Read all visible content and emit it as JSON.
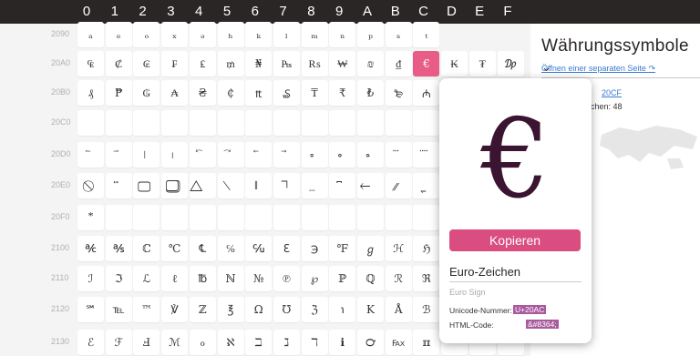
{
  "hex_columns": [
    "0",
    "1",
    "2",
    "3",
    "4",
    "5",
    "6",
    "7",
    "8",
    "9",
    "A",
    "B",
    "C",
    "D",
    "E",
    "F"
  ],
  "rows": [
    {
      "label": "2090",
      "cells": [
        "ₐ",
        "ₑ",
        "ₒ",
        "ₓ",
        "ₔ",
        "ₕ",
        "ₖ",
        "ₗ",
        "ₘ",
        "ₙ",
        "ₚ",
        "ₛ",
        "ₜ",
        "",
        "",
        ""
      ]
    },
    {
      "label": "20A0",
      "cells": [
        "₠",
        "₡",
        "₢",
        "₣",
        "₤",
        "₥",
        "₦",
        "₧",
        "₨",
        "₩",
        "₪",
        "₫",
        "€",
        "₭",
        "₮",
        "₯"
      ]
    },
    {
      "label": "20B0",
      "cells": [
        "₰",
        "₱",
        "₲",
        "₳",
        "₴",
        "₵",
        "₶",
        "₷",
        "₸",
        "₹",
        "₺",
        "₻",
        "₼",
        "",
        "",
        ""
      ]
    },
    {
      "label": "20C0",
      "cells": [
        "",
        "",
        "",
        "",
        "",
        "",
        "",
        "",
        "",
        "",
        "",
        "",
        "",
        "",
        "",
        ""
      ]
    },
    {
      "label": "20D0",
      "cells": [
        "⃐",
        "⃑",
        "⃒",
        "⃓",
        "⃔",
        "⃕",
        "⃖",
        "⃗",
        "⃘",
        "⃙",
        "⃚",
        "⃛",
        "⃜",
        "",
        "",
        ""
      ]
    },
    {
      "label": "20E0",
      "cells": [
        "⃠",
        "⃡",
        "⃢",
        "⃣",
        "⃤",
        "⃥",
        "⃦",
        "⃧",
        "⃨",
        "⃩",
        "⃪",
        "⃫",
        "⃬",
        "",
        "",
        ""
      ]
    },
    {
      "label": "20F0",
      "cells": [
        "⃰",
        "",
        "",
        "",
        "",
        "",
        "",
        "",
        "",
        "",
        "",
        "",
        "",
        "",
        "",
        ""
      ]
    },
    {
      "label": "2100",
      "cells": [
        "℀",
        "℁",
        "ℂ",
        "℃",
        "℄",
        "℅",
        "℆",
        "ℇ",
        "℈",
        "℉",
        "ℊ",
        "ℋ",
        "ℌ",
        "",
        "",
        ""
      ]
    },
    {
      "label": "2110",
      "cells": [
        "ℐ",
        "ℑ",
        "ℒ",
        "ℓ",
        "℔",
        "ℕ",
        "№",
        "℗",
        "℘",
        "ℙ",
        "ℚ",
        "ℛ",
        "ℜ",
        "",
        "",
        ""
      ]
    },
    {
      "label": "2120",
      "cells": [
        "℠",
        "℡",
        "™",
        "℣",
        "ℤ",
        "℥",
        "Ω",
        "℧",
        "ℨ",
        "℩",
        "K",
        "Å",
        "ℬ",
        "",
        "",
        ""
      ]
    },
    {
      "label": "2130",
      "cells": [
        "ℰ",
        "ℱ",
        "Ⅎ",
        "ℳ",
        "ℴ",
        "ℵ",
        "ℶ",
        "ℷ",
        "ℸ",
        "ℹ",
        "℺",
        "℻",
        "ℼ",
        "",
        "",
        ""
      ]
    }
  ],
  "sidebar": {
    "title": "Währungssymbole",
    "dropdown_icon": "chevron-down-icon",
    "separate_page_link": "Öffnen einer separaten Seite",
    "range_link": "20CF",
    "count_text": "chen: 48"
  },
  "popup": {
    "symbol": "€",
    "copy_button": "Kopieren",
    "name": "Euro-Zeichen",
    "english_name": "Euro Sign",
    "unicode_label": "Unicode-Nummer:",
    "unicode_value": "U+20AC",
    "html_label": "HTML-Code:",
    "html_value": "&#8364;"
  },
  "colors": {
    "header": "#2b2626",
    "selected": "#e85d88",
    "button": "#d94d80",
    "code_bg": "#a85a9c"
  }
}
